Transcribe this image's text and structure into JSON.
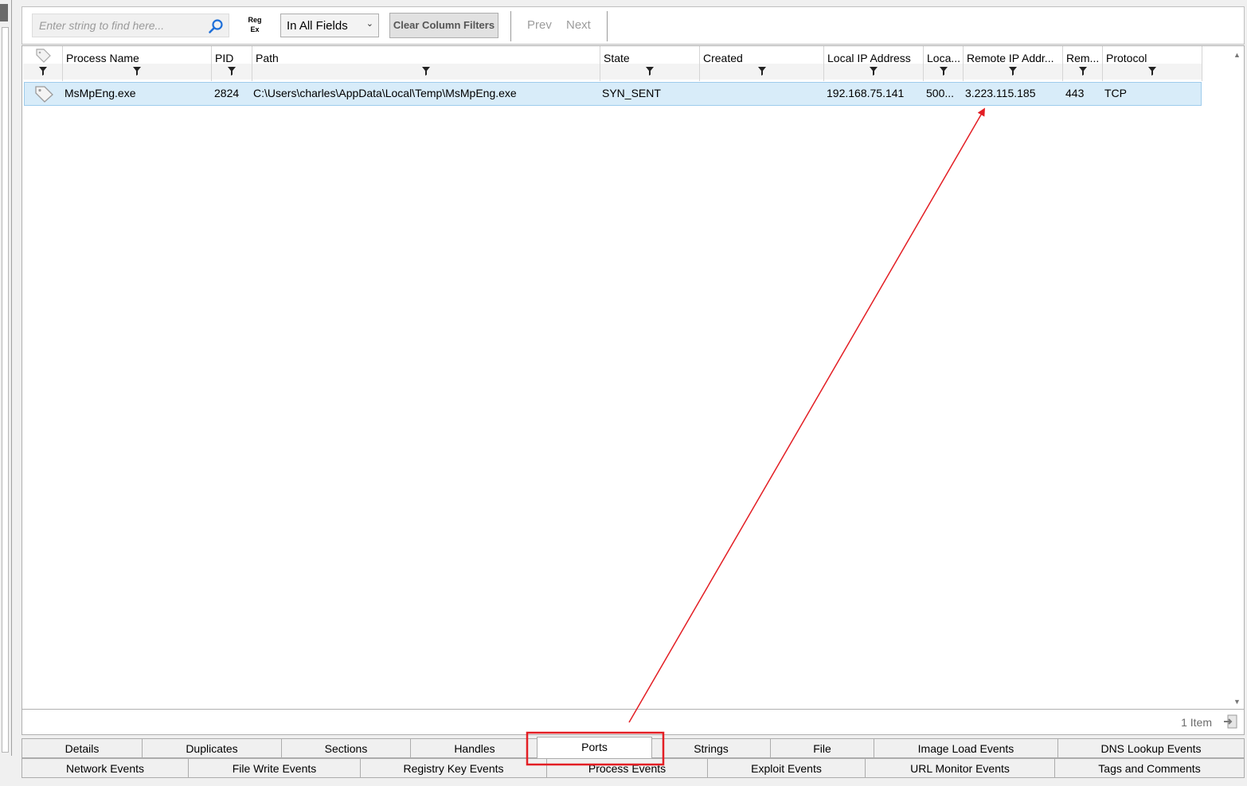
{
  "toolbar": {
    "search_placeholder": "Enter string to find here...",
    "regex_line1": "Reg",
    "regex_line2": "Ex",
    "field_select": "In All Fields",
    "clear_filters": "Clear Column Filters",
    "prev": "Prev",
    "next": "Next"
  },
  "columns": [
    {
      "key": "tag",
      "label": ""
    },
    {
      "key": "process_name",
      "label": "Process Name"
    },
    {
      "key": "pid",
      "label": "PID"
    },
    {
      "key": "path",
      "label": "Path"
    },
    {
      "key": "state",
      "label": "State"
    },
    {
      "key": "created",
      "label": "Created"
    },
    {
      "key": "local_ip",
      "label": "Local IP Address"
    },
    {
      "key": "local_port",
      "label": "Loca..."
    },
    {
      "key": "remote_ip",
      "label": "Remote IP Addr..."
    },
    {
      "key": "remote_port",
      "label": "Rem..."
    },
    {
      "key": "protocol",
      "label": "Protocol"
    }
  ],
  "rows": [
    {
      "process_name": "MsMpEng.exe",
      "pid": "2824",
      "path": "C:\\Users\\charles\\AppData\\Local\\Temp\\MsMpEng.exe",
      "state": "SYN_SENT",
      "created": "",
      "local_ip": "192.168.75.141",
      "local_port": "500...",
      "remote_ip": "3.223.115.185",
      "remote_port": "443",
      "protocol": "TCP"
    }
  ],
  "status": {
    "item_count": "1 Item"
  },
  "tabs_row1": [
    "Details",
    "Duplicates",
    "Sections",
    "Handles",
    "Ports",
    "Strings",
    "File",
    "Image Load Events",
    "DNS Lookup Events"
  ],
  "tabs_row2": [
    "Network Events",
    "File Write Events",
    "Registry Key Events",
    "Process Events",
    "Exploit Events",
    "URL Monitor Events",
    "Tags and Comments"
  ],
  "active_tab": "Ports",
  "annotation_color": "#e31e24",
  "selection_color": "#d8ecf9"
}
